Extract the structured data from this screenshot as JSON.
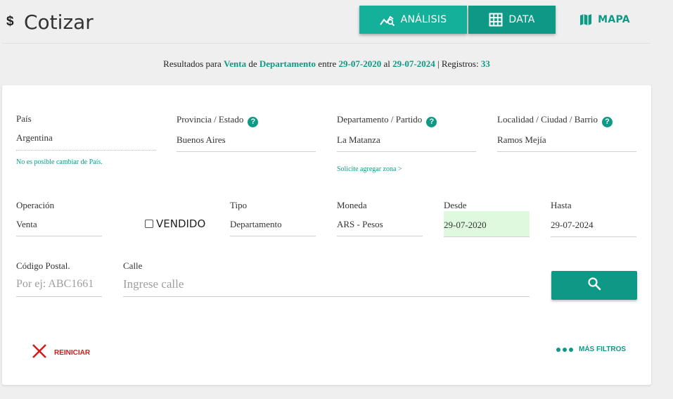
{
  "header": {
    "currency_symbol": "$",
    "title": "Cotizar",
    "tabs": [
      {
        "label": "ANÁLISIS",
        "icon": "chart-search-icon"
      },
      {
        "label": "DATA",
        "icon": "table-grid-icon"
      },
      {
        "label": "MAPA",
        "icon": "map-icon"
      }
    ]
  },
  "results": {
    "prefix": "Resultados para",
    "operation": "Venta",
    "de": "de",
    "type": "Departamento",
    "entre": "entre",
    "from": "29-07-2020",
    "al": "al",
    "to": "29-07-2024",
    "registros_label": "| Registros:",
    "count": "33"
  },
  "form": {
    "pais": {
      "label": "País",
      "value": "Argentina",
      "note": "No es posible cambiar de País."
    },
    "provincia": {
      "label": "Provincia / Estado",
      "value": "Buenos Aires"
    },
    "departamento": {
      "label": "Departamento / Partido",
      "value": "La Matanza",
      "note": "Solicite agregar zona >"
    },
    "localidad": {
      "label": "Localidad / Ciudad / Barrio",
      "value": "Ramos Mejía"
    },
    "operacion": {
      "label": "Operación",
      "value": "Venta"
    },
    "vendido": {
      "label": "VENDIDO",
      "checked": false
    },
    "tipo": {
      "label": "Tipo",
      "value": "Departamento"
    },
    "moneda": {
      "label": "Moneda",
      "value": "ARS - Pesos"
    },
    "desde": {
      "label": "Desde",
      "value": "29-07-2020"
    },
    "hasta": {
      "label": "Hasta",
      "value": "29-07-2024"
    },
    "codigo_postal": {
      "label": "Código Postal.",
      "placeholder": "Por ej: ABC1661"
    },
    "calle": {
      "label": "Calle",
      "placeholder": "Ingrese calle"
    },
    "help_glyph": "?"
  },
  "actions": {
    "search_icon": "search-icon",
    "reset_label": "REINICIAR",
    "more_filters_label": "MÁS FILTROS"
  },
  "colors": {
    "accent": "#0e9986",
    "accent_light": "#15b09a",
    "danger": "#d11c1c",
    "date_highlight": "#dff9df"
  }
}
